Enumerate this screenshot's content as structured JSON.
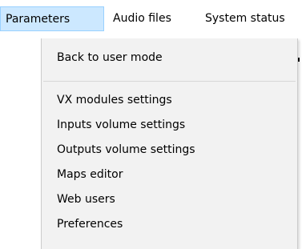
{
  "menubar": {
    "items": [
      {
        "label": "Parameters",
        "active": true
      },
      {
        "label": "Audio files",
        "active": false
      },
      {
        "label": "System status",
        "active": false
      }
    ]
  },
  "parameters_menu": {
    "items": [
      {
        "label": "Back to user mode"
      },
      {
        "label": "VX modules settings"
      },
      {
        "label": "Inputs volume settings"
      },
      {
        "label": "Outputs volume settings"
      },
      {
        "label": "Maps editor"
      },
      {
        "label": "Web users"
      },
      {
        "label": "Preferences"
      }
    ]
  },
  "colors": {
    "menu_background": "#f2f2f2",
    "active_highlight": "#cce8ff",
    "active_border": "#99d1ff",
    "separator": "#d7d7d7"
  }
}
